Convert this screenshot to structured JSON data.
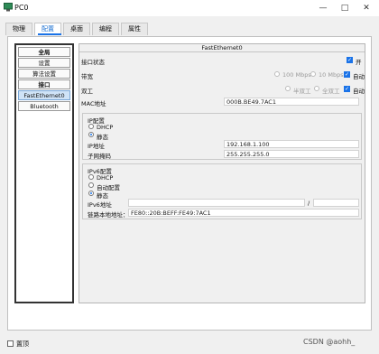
{
  "window": {
    "title": "PC0",
    "minimize": "—",
    "maximize": "□",
    "close": "✕"
  },
  "tabs": [
    {
      "label": "物理"
    },
    {
      "label": "配置",
      "active": true
    },
    {
      "label": "桌面"
    },
    {
      "label": "编程"
    },
    {
      "label": "属性"
    }
  ],
  "sidebar": {
    "items": [
      {
        "label": "全局",
        "bold": true
      },
      {
        "label": "设置"
      },
      {
        "label": "算法设置"
      },
      {
        "label": "接口",
        "bold": true
      },
      {
        "label": "FastEthernet0",
        "selected": true
      },
      {
        "label": "Bluetooth"
      }
    ]
  },
  "panel": {
    "title": "FastEthernet0",
    "port_status": {
      "label": "接口状态",
      "checked": true,
      "value": "开"
    },
    "bandwidth": {
      "label": "带宽",
      "opt1": "100 Mbps",
      "opt2": "10 Mbps",
      "auto": "自动"
    },
    "duplex": {
      "label": "双工",
      "opt1": "半双工",
      "opt2": "全双工",
      "auto": "自动"
    },
    "mac": {
      "label": "MAC地址",
      "value": "000B.BE49.7AC1"
    },
    "ip_config": {
      "title": "IP配置",
      "dhcp": "DHCP",
      "static": "静态",
      "selected": "static",
      "ip_label": "IP地址",
      "ip_value": "192.168.1.100",
      "mask_label": "子网掩码",
      "mask_value": "255.255.255.0"
    },
    "ipv6_config": {
      "title": "IPv6配置",
      "dhcp": "DHCP",
      "auto": "自动配置",
      "static": "静态",
      "selected": "static",
      "ipv6_label": "IPv6地址",
      "ipv6_value": "",
      "prefix_sep": "/",
      "link_local_label": "链路本地地址：",
      "link_local_value": "FE80::20B:BEFF:FE49:7AC1"
    }
  },
  "footer": {
    "pin_label": "置顶",
    "pin_checked": false
  },
  "watermark": "CSDN @aohh_"
}
